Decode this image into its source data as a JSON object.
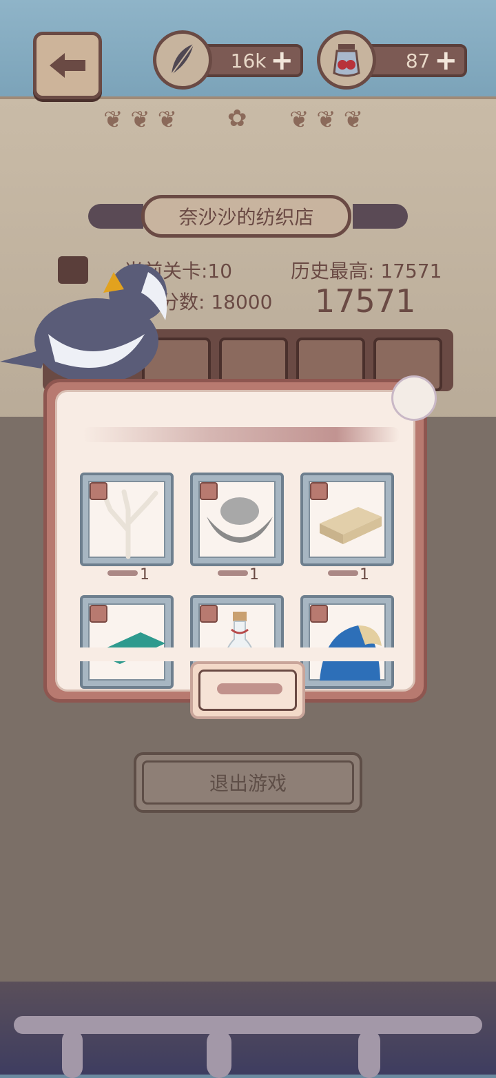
{
  "hud": {
    "feather_amount": "16k",
    "gem_amount": "87",
    "plus_symbol": "+"
  },
  "shop": {
    "title": "奈沙沙的纺织店"
  },
  "stats": {
    "current_level_label": "当前关卡:10",
    "best_label": "历史最高: 17571",
    "score_label": "分数: 18000",
    "score_big": "17571"
  },
  "reward_dialog": {
    "items": [
      {
        "icon": "coral",
        "qty": "1"
      },
      {
        "icon": "silver-ingot",
        "qty": "1"
      },
      {
        "icon": "linen-cloth",
        "qty": "1"
      },
      {
        "icon": "teal-fabric",
        "qty": ""
      },
      {
        "icon": "glass-bottle",
        "qty": ""
      },
      {
        "icon": "blue-shell",
        "qty": ""
      }
    ]
  },
  "exit_button": {
    "label": "退出游戏"
  },
  "colors": {
    "frame_brown": "#6a4a44",
    "dialog_rose": "#b87a70",
    "overlay": "#7b6f67"
  }
}
